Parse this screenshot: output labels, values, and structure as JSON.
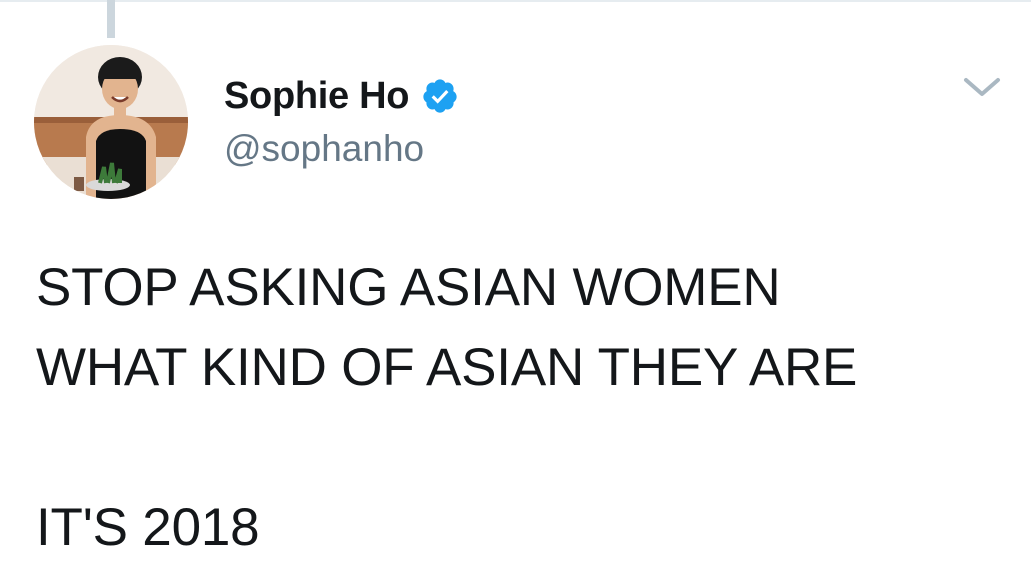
{
  "tweet": {
    "author": {
      "display_name": "Sophie Ho",
      "handle": "@sophanho",
      "verified": true,
      "avatar_icon": "profile-photo"
    },
    "menu_icon": "chevron-down-icon",
    "text_lines": [
      "STOP ASKING ASIAN WOMEN",
      "WHAT KIND OF ASIAN THEY ARE",
      "",
      "IT'S 2018"
    ]
  },
  "colors": {
    "text_primary": "#14171a",
    "text_secondary": "#657786",
    "verified_badge": "#1da1f2",
    "thread_line": "#ccd6dd",
    "caret": "#aab8c2"
  }
}
